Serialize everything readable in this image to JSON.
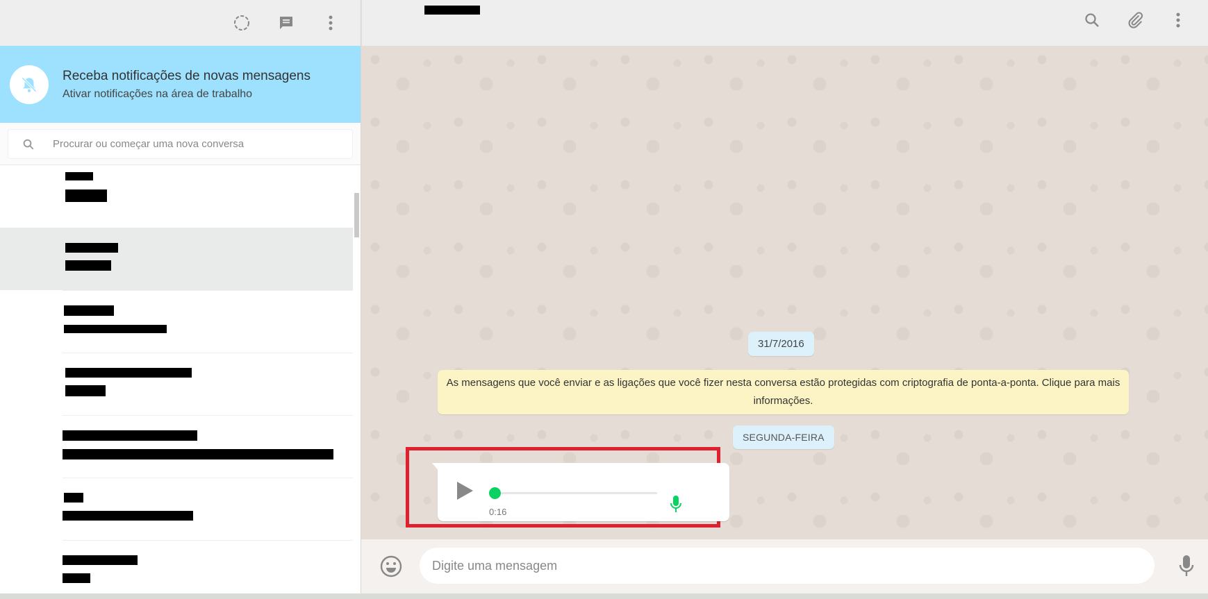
{
  "left": {
    "header_icons": [
      "status-icon",
      "new-chat-icon",
      "menu-icon"
    ],
    "notification": {
      "title": "Receba notificações de novas mensagens",
      "subtitle": "Ativar notificações na área de trabalho"
    },
    "search": {
      "placeholder": "Procurar ou começar uma nova conversa"
    }
  },
  "right": {
    "header_icons": [
      "search-icon",
      "attach-icon",
      "menu-icon"
    ],
    "messages": {
      "date": "31/7/2016",
      "crypto_notice": "As mensagens que você enviar e as ligações que você fizer nesta conversa estão protegidas com criptografia de ponta-a-ponta. Clique para mais informações.",
      "day": "SEGUNDA-FEIRA",
      "voice": {
        "duration": "0:16",
        "progress": 0
      }
    },
    "composer": {
      "placeholder": "Digite uma mensagem"
    }
  },
  "colors": {
    "notification_bg": "#9de1fe",
    "chat_bg": "#e5ddd5",
    "voice_accent": "#09d261",
    "highlight": "#e0202e"
  }
}
